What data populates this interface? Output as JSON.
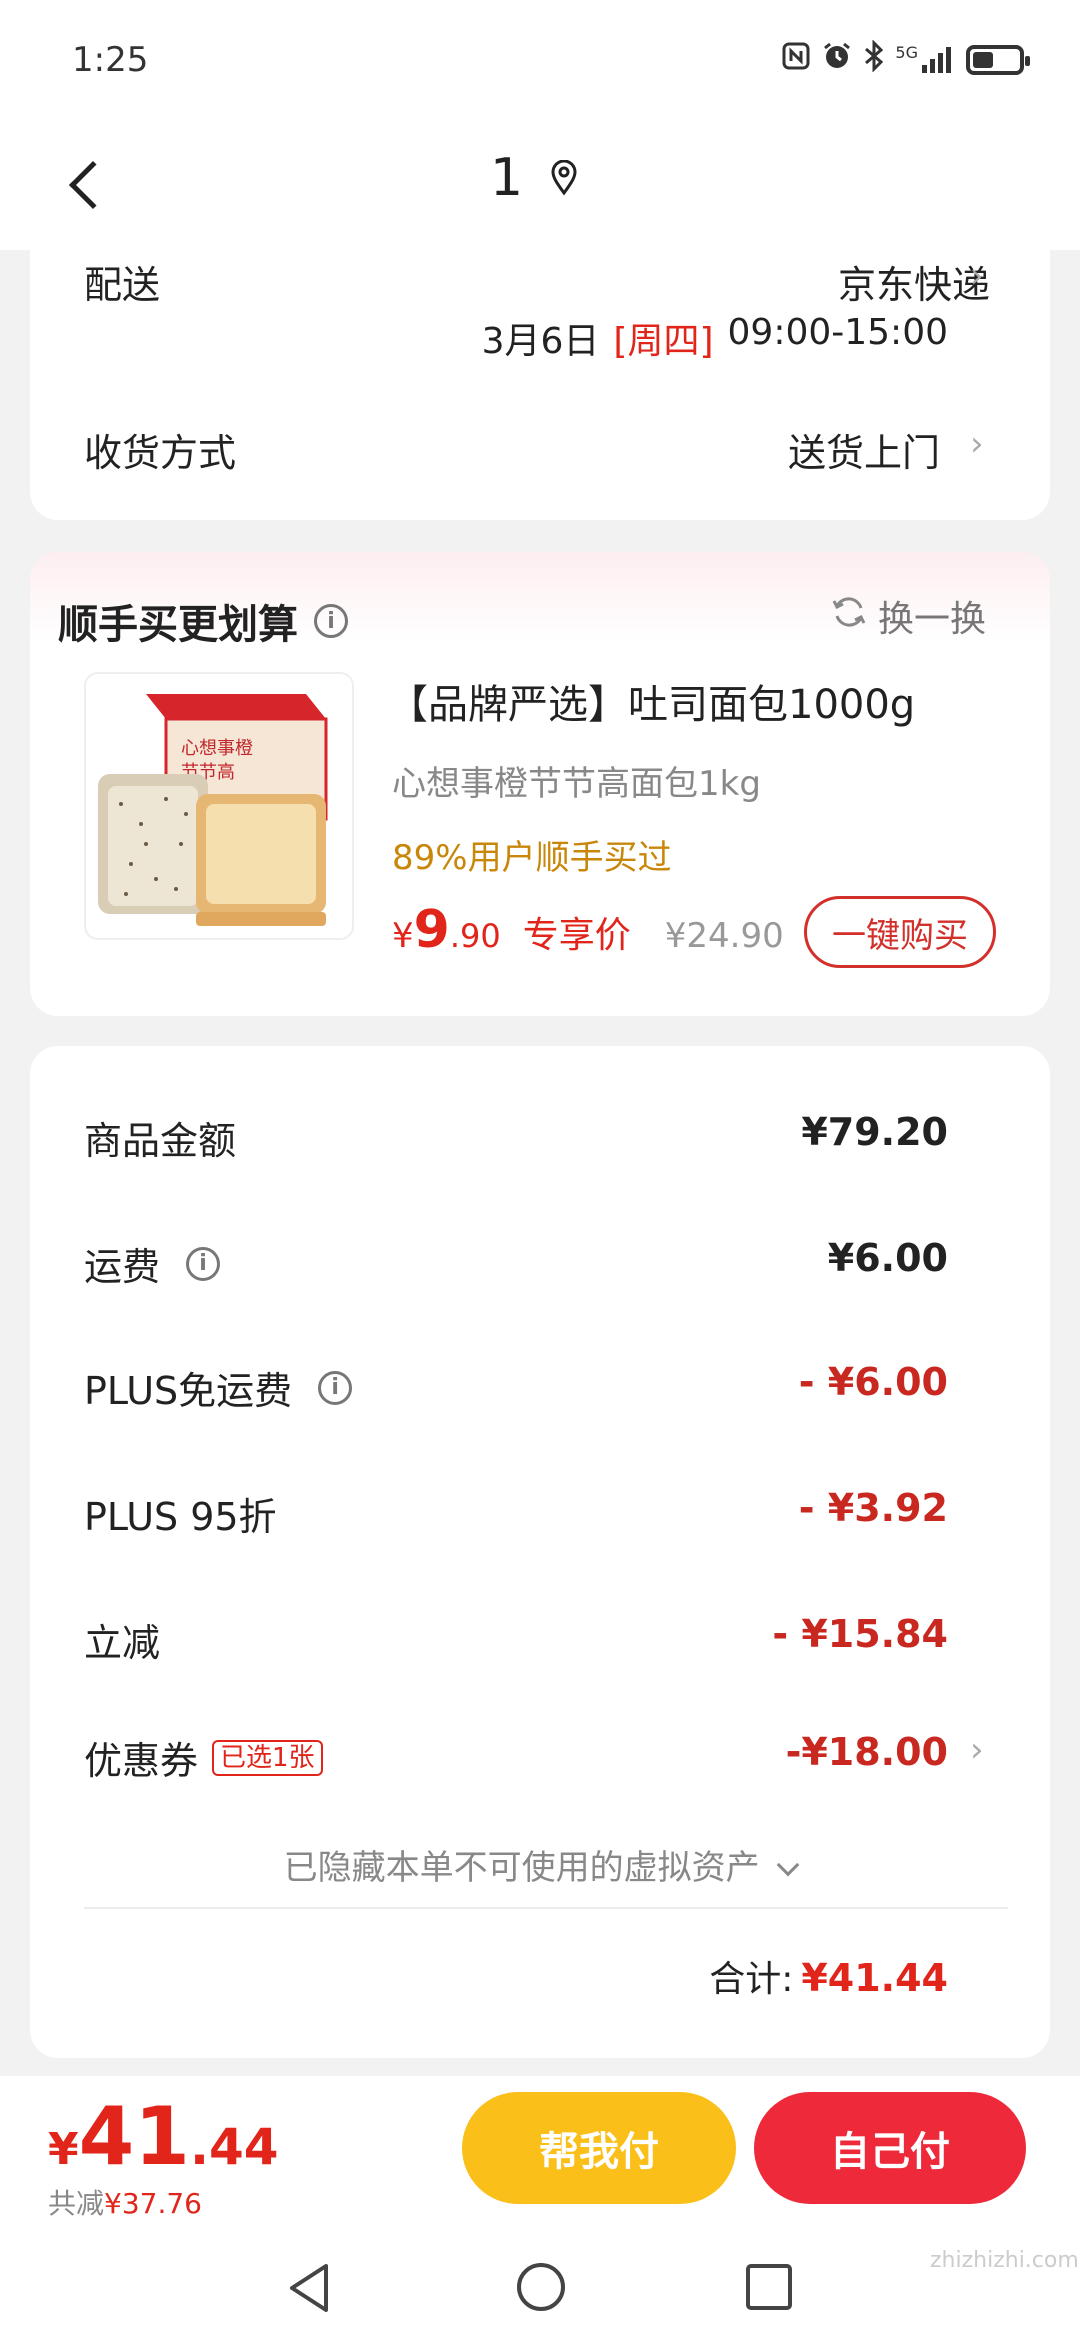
{
  "status_bar": {
    "time": "1:25",
    "network": "5G"
  },
  "header": {
    "title": "1"
  },
  "delivery": {
    "label": "配送",
    "carrier": "京东快递",
    "date": "3月6日",
    "weekday": "[周四]",
    "time_window": "09:00-15:00",
    "receive_label": "收货方式",
    "receive_value": "送货上门"
  },
  "addon": {
    "title": "顺手买更划算",
    "swap_label": "换一换",
    "product": {
      "name": "【品牌严选】吐司面包1000g",
      "subtitle": "心想事橙节节高面包1kg",
      "hint": "89%用户顺手买过",
      "price_yen": "¥",
      "price_int": "9",
      "price_dec": ".90",
      "price_tag": "专享价",
      "original_price": "¥24.90",
      "buy_label": "一键购买",
      "image_text": "心想事橙节节高"
    }
  },
  "summary": {
    "items": [
      {
        "label": "商品金额",
        "value": "¥79.20"
      },
      {
        "label": "运费",
        "value": "¥6.00"
      },
      {
        "label": "PLUS免运费",
        "value": "- ¥6.00"
      },
      {
        "label": "PLUS 95折",
        "value": "- ¥3.92"
      },
      {
        "label": "立减",
        "value": "- ¥15.84"
      },
      {
        "label": "优惠券",
        "value": "-¥18.00",
        "tag": "已选1张"
      }
    ],
    "hidden_assets": "已隐藏本单不可使用的虚拟资产",
    "total_label": "合计:",
    "total_value": "¥41.44"
  },
  "bottom": {
    "yen": "¥",
    "total_int": "41",
    "total_dec": ".44",
    "saved_label": "共减",
    "saved_value": "¥37.76",
    "help_pay": "帮我付",
    "self_pay": "自己付"
  },
  "watermark": "zhizhizhi.com",
  "colors": {
    "accent_red": "#e1251b",
    "help_pay_yellow": "#fbbf1a",
    "self_pay_red": "#ee2a3a",
    "hint_orange": "#c9870a"
  }
}
